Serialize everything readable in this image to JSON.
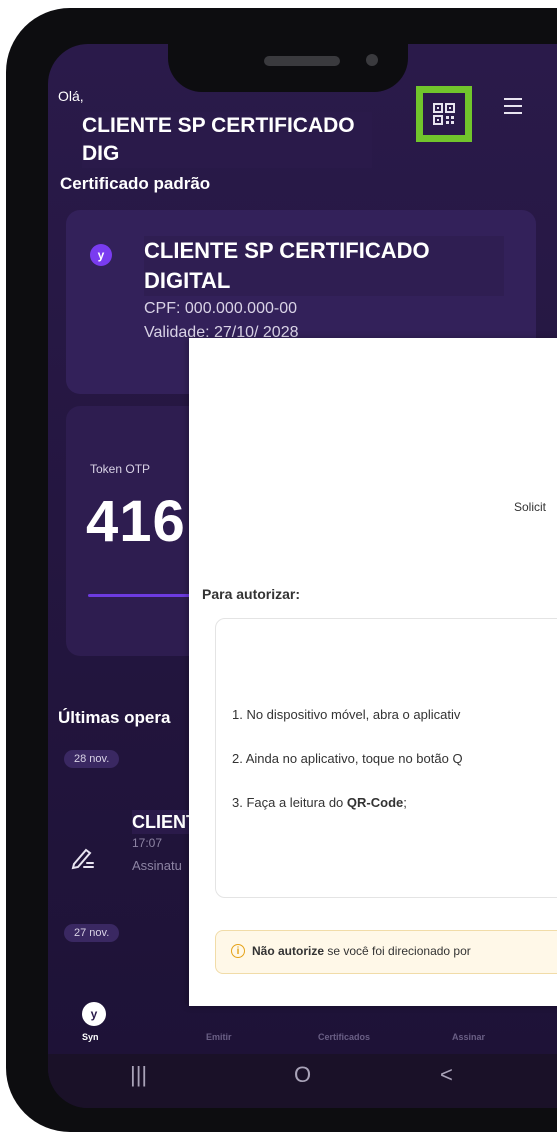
{
  "header": {
    "greeting": "Olá,",
    "user_name": "CLIENTE SP CERTIFICADO DIG",
    "section_title": "Certificado padrão"
  },
  "certificate": {
    "name": "CLIENTE SP CERTIFICADO DIGITAL",
    "cpf": "CPF: 000.000.000-00",
    "validity": "Validade: 27/10/ 2028",
    "logo_letter": "y"
  },
  "token": {
    "label": "Token OTP",
    "value": "416",
    "progress": 0.6
  },
  "operations": {
    "title": "Últimas opera",
    "date_1": "28 nov.",
    "item_name": "CLIENTE DIGIT",
    "item_time": "17:07",
    "item_type": "Assinatu",
    "date_2": "27 nov."
  },
  "tabbar": {
    "items": [
      "Syn",
      "Emitir",
      "Certificados",
      "Assinar"
    ]
  },
  "navbar": {
    "recent": "|||",
    "home": "O",
    "back": "<"
  },
  "modal": {
    "solicit": "Solicit",
    "para_autorizar": "Para autorizar:",
    "step1": "1. No dispositivo móvel, abra o aplicativ",
    "step2": "2. Ainda no aplicativo, toque no botão Q",
    "step3_prefix": "3. Faça a leitura do ",
    "step3_bold": "QR-Code",
    "step3_suffix": ";",
    "warn_bold": "Não autorize",
    "warn_text": " se você foi direcionado por"
  },
  "colors": {
    "background": "#2a1a4a",
    "accent": "#7a3cf0",
    "highlight_box": "#71c52c",
    "warning": "#e5a31a"
  },
  "icons": {
    "qr": "qr-code-icon",
    "menu": "hamburger-menu-icon",
    "signature": "pen-signature-icon",
    "info": "info-icon"
  }
}
